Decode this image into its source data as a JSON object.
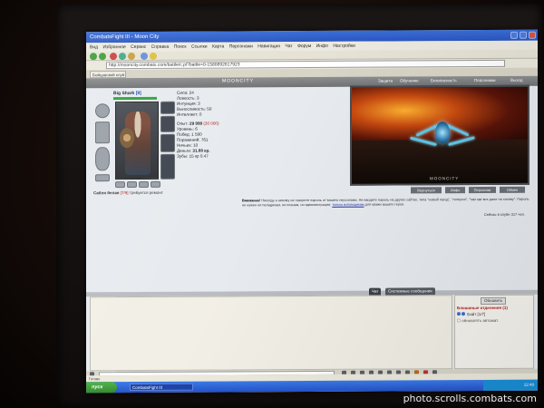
{
  "window": {
    "title": "CombatsFight III - Moon City"
  },
  "browser": {
    "menu": [
      "Вид",
      "Избранное",
      "Сервис",
      "Справка",
      "Поиск",
      "Ссылки",
      "Карта",
      "Персонажи",
      "Навигация",
      "Чат",
      "Форум",
      "Инфо",
      "Настройки"
    ],
    "address": "http://mooncity.combats.com/battle/c.pl?battle=0-1580892617923"
  },
  "tab": {
    "label": "Бойцовский клуб"
  },
  "nav": {
    "logo": "MOONCITY",
    "items": [
      "Защита",
      "Обучение",
      "Безопасность",
      "Персонажи",
      "Выход"
    ]
  },
  "character": {
    "name": "Big Shark",
    "level": "[9]",
    "caption_prefix": "Сабля белая",
    "caption_level": "[7/9]",
    "caption_suffix": "требуется ремонт"
  },
  "stats": {
    "lines": [
      "Сила: 24",
      "Ловкость: 3",
      "Интуиция: 3",
      "Выносливость: 50",
      "Интеллект: 0"
    ],
    "exp_label": "Опыт:",
    "exp_value": "29 999",
    "exp_next": "(30 000)",
    "details": [
      "Уровень: 6",
      "Побед: 1 590",
      "Поражений: 761",
      "Ничьих: 10"
    ],
    "money_label": "Деньги:",
    "money_value": "31.88 кр.",
    "extra": "Зубы: 15 кр 0.47"
  },
  "arena": {
    "label": "MOONCITY"
  },
  "actions": [
    "Вернуться",
    "Инфо",
    "Персонаж",
    "Обмен"
  ],
  "notice": {
    "bold": "Внимание!",
    "text": "Никогда и никому не говорите пароль от вашего персонажа. Не вводите пароль на других сайтах, типа \"новый город\", \"лотерея\", \"там где все дают на халяву\". Пароль не нужен ни паладинам, ни кланам, ни администрации,",
    "link": "только взломщикам",
    "tail": "для кражи вашего героя."
  },
  "online": "Сейчас в клубе 317 чел.",
  "chat": {
    "tabs": [
      "Чат",
      "Системные сообщения"
    ],
    "refresh": "Обновить",
    "room": "Блошиные отделения (1)",
    "user": "Байт [1/7]",
    "auto_update": "обновлять автомат."
  },
  "taskbar": {
    "start": "пуск",
    "item": "CombatsFight III",
    "time": "12:48"
  },
  "status": "Готово",
  "watermark": "photo.scrolls.combats.com"
}
